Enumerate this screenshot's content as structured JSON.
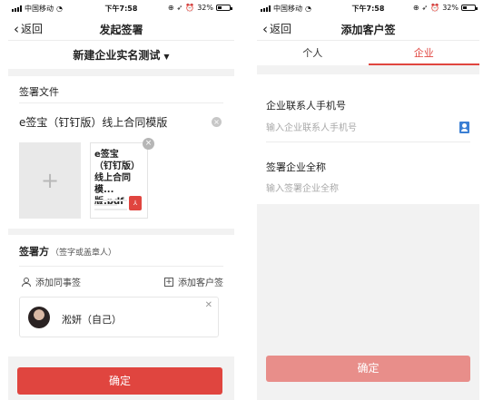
{
  "status_bar": {
    "carrier": "中国移动",
    "time": "下午7:58",
    "battery": "32%",
    "battery_level": 0.32
  },
  "left_screen": {
    "nav": {
      "back_label": "返回",
      "title": "发起签署"
    },
    "template": {
      "name": "新建企业实名测试"
    },
    "documents": {
      "section_label": "签署文件",
      "title": "e签宝（钉钉版）线上合同模版",
      "file_name": "e签宝（钉钉版）线上合同模...版.pdf",
      "file_type_icon": "pdf-icon"
    },
    "signers": {
      "title": "签署方",
      "hint": "（签字或盖章人）",
      "add_colleague_label": "添加同事签",
      "add_customer_label": "添加客户签",
      "list": [
        {
          "name": "淞妍（自己）"
        }
      ]
    },
    "confirm_label": "确定",
    "colors": {
      "accent": "#e0453f"
    }
  },
  "right_screen": {
    "nav": {
      "back_label": "返回",
      "title": "添加客户签"
    },
    "tabs": [
      {
        "label": "个人",
        "active": false
      },
      {
        "label": "企业",
        "active": true
      }
    ],
    "form": {
      "phone_label": "企业联系人手机号",
      "phone_placeholder": "输入企业联系人手机号",
      "phone_value": "",
      "company_label": "签署企业全称",
      "company_placeholder": "输入签署企业全称",
      "company_value": ""
    },
    "confirm_label": "确定",
    "colors": {
      "accent": "#e0453f",
      "button_disabled": "#e88e8a"
    }
  }
}
